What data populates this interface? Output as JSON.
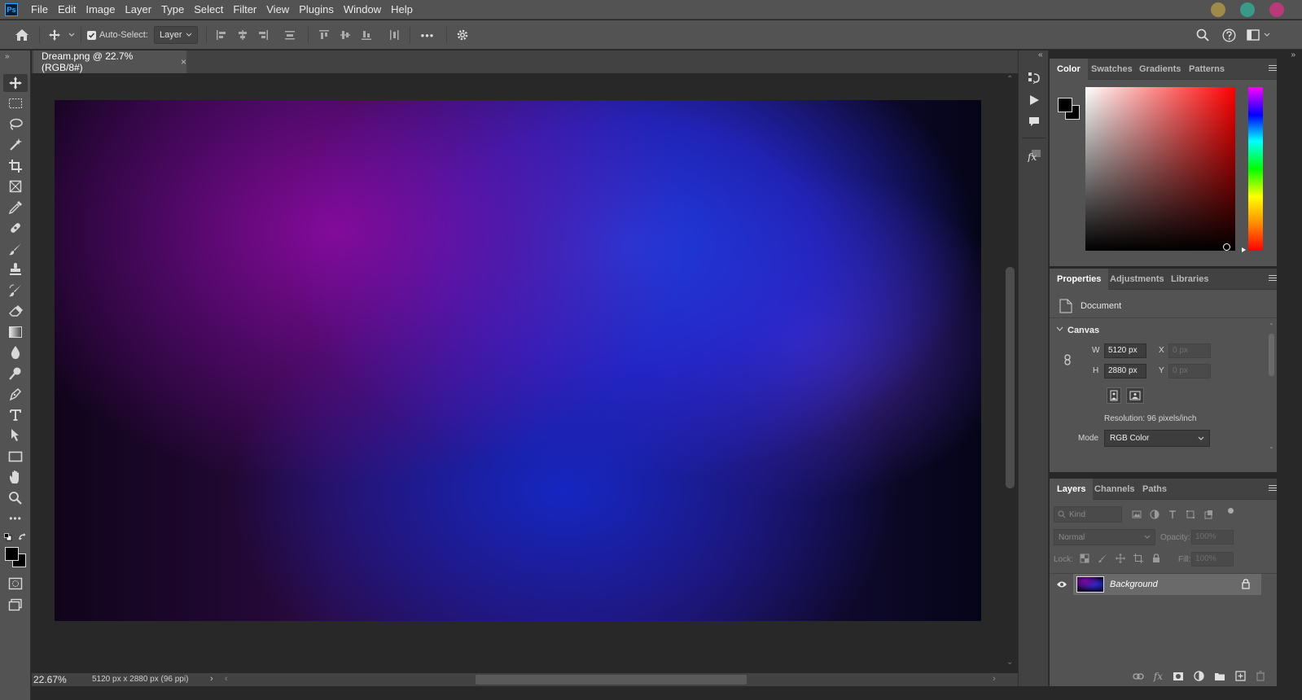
{
  "app": {
    "logo_text": "Ps"
  },
  "menu": [
    "File",
    "Edit",
    "Image",
    "Layer",
    "Type",
    "Select",
    "Filter",
    "View",
    "Plugins",
    "Window",
    "Help"
  ],
  "collab_colors": [
    "#a08a4a",
    "#3a9a88",
    "#b83a78"
  ],
  "options_bar": {
    "auto_select_label": "Auto-Select:",
    "auto_select_checked": true,
    "target_value": "Layer",
    "more_label": "•••"
  },
  "document": {
    "tab_title": "Dream.png @ 22.7% (RGB/8#)",
    "close_glyph": "×",
    "zoom": "22.67%",
    "status_info": "5120 px x 2880 px (96 ppi)",
    "status_arrow": "›",
    "scroll_left": "‹",
    "scroll_right": "›",
    "scroll_up": "⌃",
    "scroll_down": "⌄"
  },
  "color_panel": {
    "tabs": [
      "Color",
      "Swatches",
      "Gradients",
      "Patterns"
    ],
    "active_tab": "Color",
    "foreground": "#000000",
    "background": "#000000",
    "hue_base": "#ff0000"
  },
  "properties_panel": {
    "tabs": [
      "Properties",
      "Adjustments",
      "Libraries"
    ],
    "doc_label": "Document",
    "section": "Canvas",
    "w_label": "W",
    "w_value": "5120 px",
    "h_label": "H",
    "h_value": "2880 px",
    "x_label": "X",
    "x_value": "0 px",
    "y_label": "Y",
    "y_value": "0 px",
    "resolution": "Resolution: 96 pixels/inch",
    "mode_label": "Mode",
    "mode_value": "RGB Color"
  },
  "layers_panel": {
    "tabs": [
      "Layers",
      "Channels",
      "Paths"
    ],
    "kind_placeholder": "Kind",
    "blend_mode": "Normal",
    "opacity_label": "Opacity:",
    "opacity_value": "100%",
    "lock_label": "Lock:",
    "fill_label": "Fill:",
    "fill_value": "100%",
    "layers": [
      {
        "name": "Background",
        "visible": true,
        "locked": true
      }
    ],
    "footer_fx": "fx"
  }
}
